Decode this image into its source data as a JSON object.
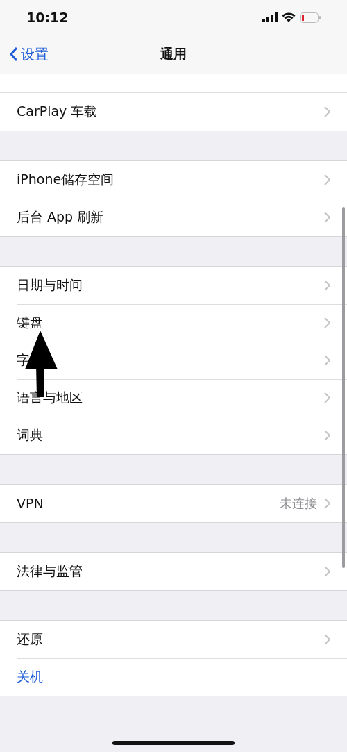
{
  "status_bar": {
    "time": "10:12"
  },
  "nav_bar": {
    "back": "设置",
    "title": "通用"
  },
  "groups": [
    {
      "items": [
        {
          "label": "CarPlay 车载",
          "kind": "link"
        }
      ]
    },
    {
      "items": [
        {
          "label": "iPhone储存空间",
          "kind": "link"
        },
        {
          "label": "后台 App 刷新",
          "kind": "link"
        }
      ]
    },
    {
      "items": [
        {
          "label": "日期与时间",
          "kind": "link"
        },
        {
          "label": "键盘",
          "kind": "link"
        },
        {
          "label": "字",
          "kind": "link"
        },
        {
          "label": "语言与地区",
          "kind": "link"
        },
        {
          "label": "词典",
          "kind": "link"
        }
      ]
    },
    {
      "items": [
        {
          "label": "VPN",
          "detail": "未连接",
          "kind": "link"
        }
      ]
    },
    {
      "items": [
        {
          "label": "法律与监管",
          "kind": "link"
        }
      ]
    },
    {
      "items": [
        {
          "label": "还原",
          "kind": "link"
        },
        {
          "label": "关机",
          "kind": "action"
        }
      ]
    }
  ]
}
